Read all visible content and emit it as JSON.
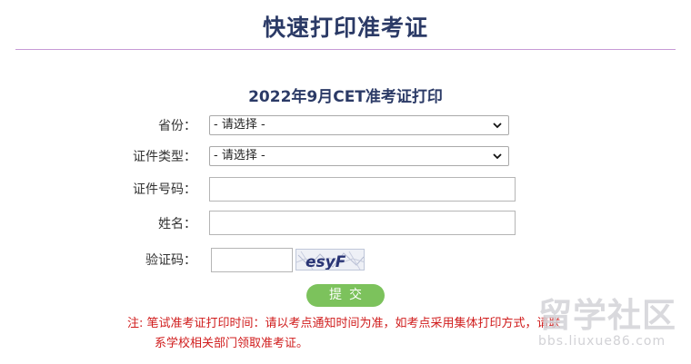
{
  "page_title": "快速打印准考证",
  "form_title": "2022年9月CET准考证打印",
  "fields": {
    "province": {
      "label": "省份：",
      "value": "- 请选择 -"
    },
    "id_type": {
      "label": "证件类型：",
      "value": "- 请选择 -"
    },
    "id_number": {
      "label": "证件号码：",
      "value": ""
    },
    "name": {
      "label": "姓名：",
      "value": ""
    },
    "captcha": {
      "label": "验证码：",
      "value": "",
      "image_text": "esyF"
    }
  },
  "submit_label": "提交",
  "notice": {
    "line1": "注: 笔试准考证打印时间：请以考点通知时间为准，如考点采用集体打印方式，请联",
    "line2": "系学校相关部门领取准考证。"
  },
  "watermark": {
    "main": "留学社区",
    "sub": "bbs.liuxue86.com"
  },
  "colors": {
    "title": "#2b3a66",
    "divider": "#c79ad6",
    "submit": "#7cc25c",
    "notice": "#d01c1c"
  }
}
